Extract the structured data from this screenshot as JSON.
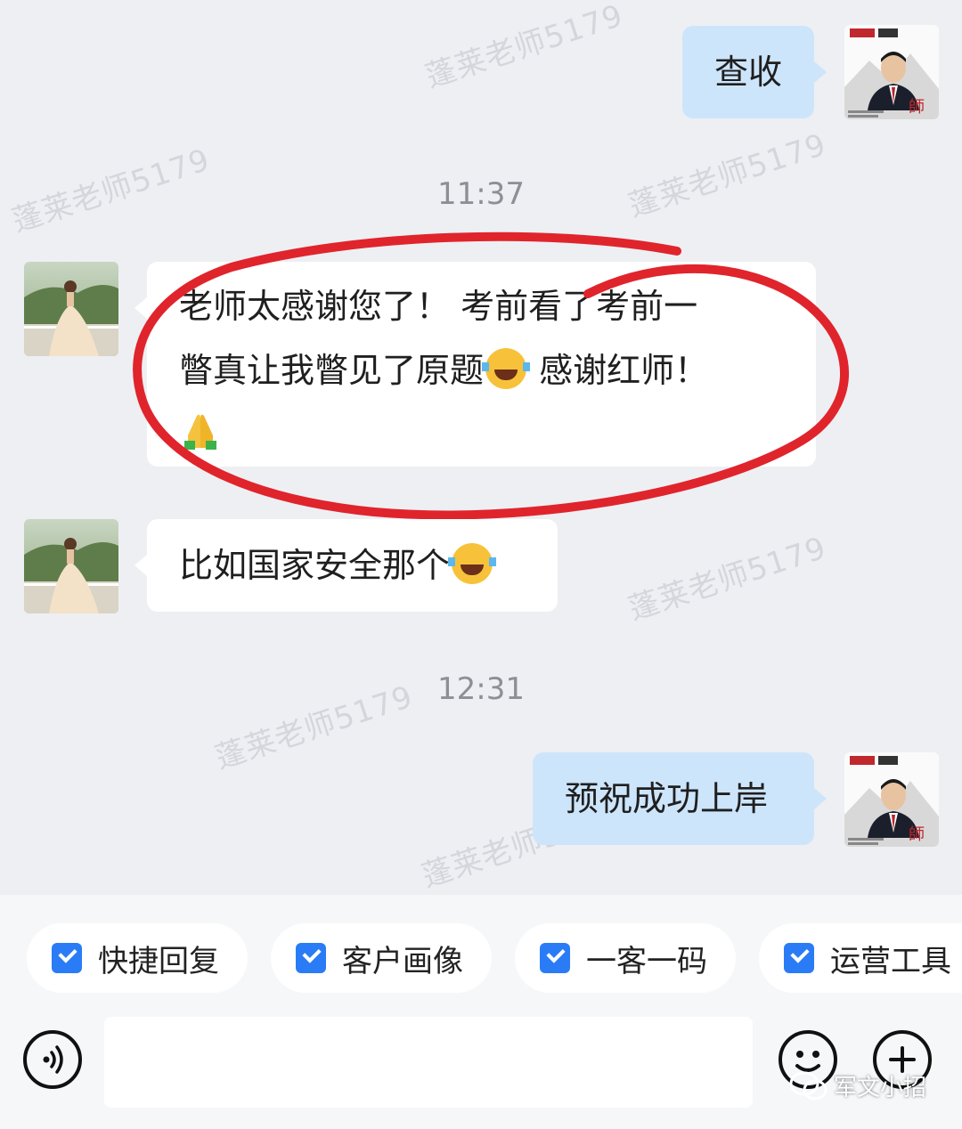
{
  "watermark_text": "蓬莱老师5179",
  "messages": [
    {
      "side": "me",
      "text": "查收",
      "avatar": "teacher-avatar"
    },
    {
      "type": "time",
      "text": "11:37"
    },
    {
      "side": "them",
      "line1": "老师太感谢您了！  考前看了考前一",
      "line2a": "瞥真让我瞥见了原题",
      "line2b": " 感谢红师！",
      "emoji": [
        "face-with-tears-of-joy",
        "folded-hands"
      ],
      "avatar": "student-avatar",
      "highlight": "red-hand-drawn-circle"
    },
    {
      "side": "them",
      "text": "比如国家安全那个",
      "emoji": [
        "face-with-tears-of-joy"
      ],
      "avatar": "student-avatar"
    },
    {
      "type": "time",
      "text": "12:31"
    },
    {
      "side": "me",
      "text": "预祝成功上岸",
      "avatar": "teacher-avatar"
    }
  ],
  "quick_tools": [
    "快捷回复",
    "客户画像",
    "一客一码",
    "运营工具"
  ],
  "input": {
    "placeholder": ""
  },
  "credit": "军文小招",
  "colors": {
    "me_bubble": "#cde5fb",
    "them_bubble": "#ffffff",
    "accent": "#2a7cf6",
    "highlight": "#e0242c"
  }
}
